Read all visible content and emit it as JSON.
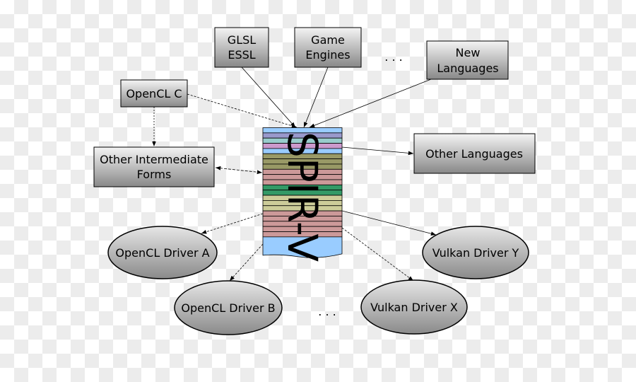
{
  "nodes": {
    "glsl": [
      "GLSL",
      "ESSL"
    ],
    "game": [
      "Game",
      "Engines"
    ],
    "new_lang": [
      "New",
      "Languages"
    ],
    "opencl_c": "OpenCL C",
    "other_ir": [
      "Other Intermediate",
      "Forms"
    ],
    "other_lang": "Other Languages",
    "driver_a": "OpenCL Driver A",
    "driver_b": "OpenCL Driver B",
    "driver_x": "Vulkan Driver X",
    "driver_y": "Vulkan Driver Y",
    "ellipsis_top": ". . .",
    "ellipsis_bottom": ". . ."
  },
  "spirv": {
    "label": "SPIR-V",
    "stripe_colors": [
      "#99ccff",
      "#9999cc",
      "#99cccc",
      "#cc99cc",
      "#99ccff",
      "#999966",
      "#999966",
      "#999966",
      "#cc9999",
      "#cc9999",
      "#cc9999",
      "#339966",
      "#339966",
      "#cccc99",
      "#cccc99",
      "#cccc99",
      "#cc9999",
      "#cc9999",
      "#cc9999",
      "#cc9999",
      "#cc9999"
    ],
    "tail_color": "#99ccff"
  }
}
